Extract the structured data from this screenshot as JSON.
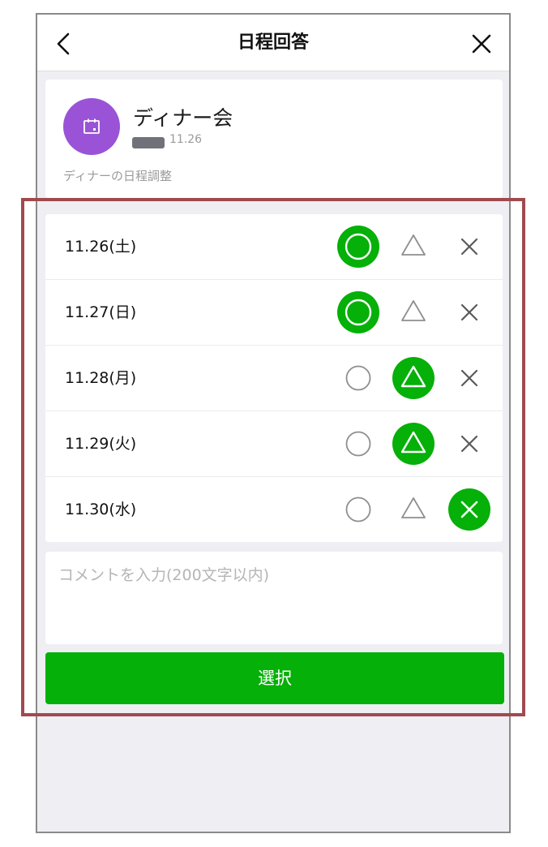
{
  "header": {
    "title": "日程回答"
  },
  "event": {
    "title": "ディナー会",
    "date": "11.26",
    "description": "ディナーの日程調整",
    "avatar_color": "#9a53d6",
    "avatar_icon": "calendar-icon"
  },
  "dates": [
    {
      "label": "11.26(土)",
      "selected": "o"
    },
    {
      "label": "11.27(日)",
      "selected": "o"
    },
    {
      "label": "11.28(月)",
      "selected": "t"
    },
    {
      "label": "11.29(火)",
      "selected": "t"
    },
    {
      "label": "11.30(水)",
      "selected": "x"
    }
  ],
  "comment": {
    "placeholder": "コメントを入力(200文字以内)",
    "value": ""
  },
  "submit_label": "選択",
  "colors": {
    "accent": "#05b008",
    "highlight_frame": "#a14a4e"
  }
}
